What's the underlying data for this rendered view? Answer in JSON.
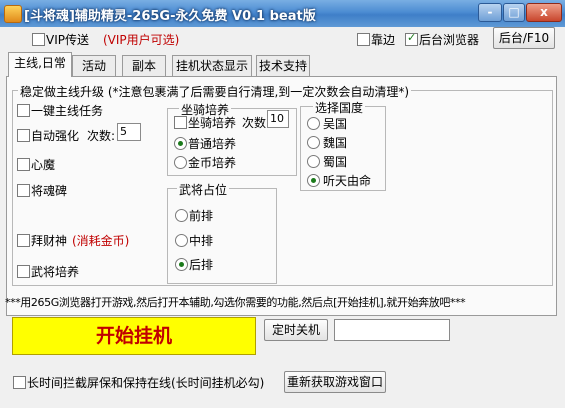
{
  "window": {
    "title": "[斗将魂]辅助精灵-265G-永久免费 V0.1 beat版",
    "minimize": "-",
    "maximize": "□",
    "close": "x"
  },
  "topbar": {
    "vip_label": "VIP传送",
    "vip_note": "(VIP用户可选)",
    "dock_label": "靠边",
    "bg_browser_label": "后台浏览器",
    "bg_button": "后台/F10"
  },
  "tabs": [
    {
      "label": "主线,日常",
      "active": true
    },
    {
      "label": "活动",
      "active": false
    },
    {
      "label": "副本",
      "active": false
    },
    {
      "label": "挂机状态显示",
      "active": false
    },
    {
      "label": "技术支持",
      "active": false
    }
  ],
  "main_group": {
    "legend": "稳定做主线升级 (*注意包裹满了后需要自行清理,到一定次数会自动清理*)",
    "main_quest": "一键主线任务",
    "auto_enhance": "自动强化",
    "times_label": "次数:",
    "times_value": "5",
    "heart_demon": "心魔",
    "general_soul": "将魂碑",
    "worship": "拜财神",
    "worship_note": "(消耗金币)",
    "general_train": "武将培养"
  },
  "mount_group": {
    "legend": "坐骑培养",
    "enable": "坐骑培养",
    "times_label": "次数",
    "times_value": "10",
    "normal": "普通培养",
    "gold": "金币培养"
  },
  "country_group": {
    "legend": "选择国度",
    "options": [
      "吴国",
      "魏国",
      "蜀国",
      "听天由命"
    ]
  },
  "position_group": {
    "legend": "武将占位",
    "options": [
      "前排",
      "中排",
      "后排"
    ]
  },
  "notice": "***用265G浏览器打开游戏,然后打开本辅助,勾选你需要的功能,然后点[开始挂机],就开始奔放吧***",
  "actions": {
    "start": "开始挂机",
    "timer_shutdown": "定时关机",
    "timer_value": "",
    "screensaver_label": "长时间拦截屏保和保持在线(长时间挂机必勾)",
    "refetch_window": "重新获取游戏窗口"
  },
  "colors": {
    "title_bar": "#4c8cd2",
    "start_bg": "#ffff00",
    "start_text": "#c00000",
    "note_red": "#c00000"
  }
}
